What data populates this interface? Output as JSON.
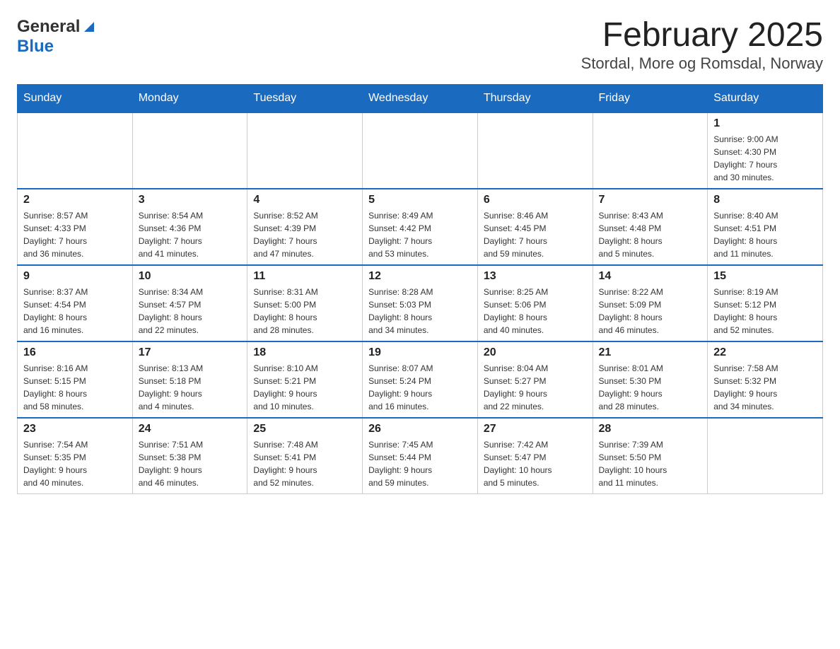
{
  "header": {
    "logo_general": "General",
    "logo_blue": "Blue",
    "title": "February 2025",
    "subtitle": "Stordal, More og Romsdal, Norway"
  },
  "days_of_week": [
    "Sunday",
    "Monday",
    "Tuesday",
    "Wednesday",
    "Thursday",
    "Friday",
    "Saturday"
  ],
  "weeks": [
    [
      {
        "day": "",
        "info": ""
      },
      {
        "day": "",
        "info": ""
      },
      {
        "day": "",
        "info": ""
      },
      {
        "day": "",
        "info": ""
      },
      {
        "day": "",
        "info": ""
      },
      {
        "day": "",
        "info": ""
      },
      {
        "day": "1",
        "info": "Sunrise: 9:00 AM\nSunset: 4:30 PM\nDaylight: 7 hours\nand 30 minutes."
      }
    ],
    [
      {
        "day": "2",
        "info": "Sunrise: 8:57 AM\nSunset: 4:33 PM\nDaylight: 7 hours\nand 36 minutes."
      },
      {
        "day": "3",
        "info": "Sunrise: 8:54 AM\nSunset: 4:36 PM\nDaylight: 7 hours\nand 41 minutes."
      },
      {
        "day": "4",
        "info": "Sunrise: 8:52 AM\nSunset: 4:39 PM\nDaylight: 7 hours\nand 47 minutes."
      },
      {
        "day": "5",
        "info": "Sunrise: 8:49 AM\nSunset: 4:42 PM\nDaylight: 7 hours\nand 53 minutes."
      },
      {
        "day": "6",
        "info": "Sunrise: 8:46 AM\nSunset: 4:45 PM\nDaylight: 7 hours\nand 59 minutes."
      },
      {
        "day": "7",
        "info": "Sunrise: 8:43 AM\nSunset: 4:48 PM\nDaylight: 8 hours\nand 5 minutes."
      },
      {
        "day": "8",
        "info": "Sunrise: 8:40 AM\nSunset: 4:51 PM\nDaylight: 8 hours\nand 11 minutes."
      }
    ],
    [
      {
        "day": "9",
        "info": "Sunrise: 8:37 AM\nSunset: 4:54 PM\nDaylight: 8 hours\nand 16 minutes."
      },
      {
        "day": "10",
        "info": "Sunrise: 8:34 AM\nSunset: 4:57 PM\nDaylight: 8 hours\nand 22 minutes."
      },
      {
        "day": "11",
        "info": "Sunrise: 8:31 AM\nSunset: 5:00 PM\nDaylight: 8 hours\nand 28 minutes."
      },
      {
        "day": "12",
        "info": "Sunrise: 8:28 AM\nSunset: 5:03 PM\nDaylight: 8 hours\nand 34 minutes."
      },
      {
        "day": "13",
        "info": "Sunrise: 8:25 AM\nSunset: 5:06 PM\nDaylight: 8 hours\nand 40 minutes."
      },
      {
        "day": "14",
        "info": "Sunrise: 8:22 AM\nSunset: 5:09 PM\nDaylight: 8 hours\nand 46 minutes."
      },
      {
        "day": "15",
        "info": "Sunrise: 8:19 AM\nSunset: 5:12 PM\nDaylight: 8 hours\nand 52 minutes."
      }
    ],
    [
      {
        "day": "16",
        "info": "Sunrise: 8:16 AM\nSunset: 5:15 PM\nDaylight: 8 hours\nand 58 minutes."
      },
      {
        "day": "17",
        "info": "Sunrise: 8:13 AM\nSunset: 5:18 PM\nDaylight: 9 hours\nand 4 minutes."
      },
      {
        "day": "18",
        "info": "Sunrise: 8:10 AM\nSunset: 5:21 PM\nDaylight: 9 hours\nand 10 minutes."
      },
      {
        "day": "19",
        "info": "Sunrise: 8:07 AM\nSunset: 5:24 PM\nDaylight: 9 hours\nand 16 minutes."
      },
      {
        "day": "20",
        "info": "Sunrise: 8:04 AM\nSunset: 5:27 PM\nDaylight: 9 hours\nand 22 minutes."
      },
      {
        "day": "21",
        "info": "Sunrise: 8:01 AM\nSunset: 5:30 PM\nDaylight: 9 hours\nand 28 minutes."
      },
      {
        "day": "22",
        "info": "Sunrise: 7:58 AM\nSunset: 5:32 PM\nDaylight: 9 hours\nand 34 minutes."
      }
    ],
    [
      {
        "day": "23",
        "info": "Sunrise: 7:54 AM\nSunset: 5:35 PM\nDaylight: 9 hours\nand 40 minutes."
      },
      {
        "day": "24",
        "info": "Sunrise: 7:51 AM\nSunset: 5:38 PM\nDaylight: 9 hours\nand 46 minutes."
      },
      {
        "day": "25",
        "info": "Sunrise: 7:48 AM\nSunset: 5:41 PM\nDaylight: 9 hours\nand 52 minutes."
      },
      {
        "day": "26",
        "info": "Sunrise: 7:45 AM\nSunset: 5:44 PM\nDaylight: 9 hours\nand 59 minutes."
      },
      {
        "day": "27",
        "info": "Sunrise: 7:42 AM\nSunset: 5:47 PM\nDaylight: 10 hours\nand 5 minutes."
      },
      {
        "day": "28",
        "info": "Sunrise: 7:39 AM\nSunset: 5:50 PM\nDaylight: 10 hours\nand 11 minutes."
      },
      {
        "day": "",
        "info": ""
      }
    ]
  ],
  "accent_color": "#1a6bbf"
}
